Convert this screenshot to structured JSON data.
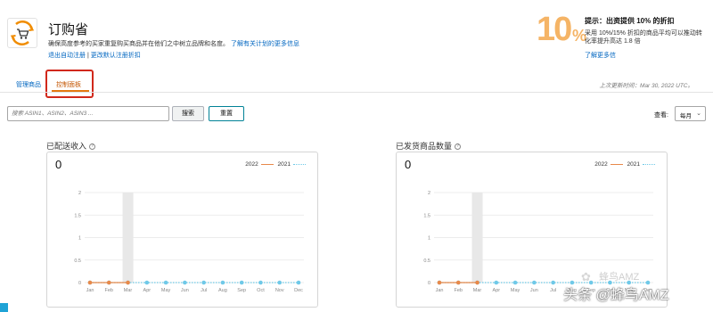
{
  "header": {
    "title": "订购省",
    "description": "确保高度参考的买家重复购买商品并在他们之中树立品牌和名度。",
    "learn_more": "了解有关计划的更多信息",
    "link_auto_enroll": "退出自动注册",
    "link_separator": "|",
    "link_change_default": "更改默认注册折扣"
  },
  "promo": {
    "number": "10",
    "percent": "%",
    "title": "提示：出资提供 10% 的折扣",
    "description": "采用 10%/15% 折扣的商品平均可以推动转化率提升高达 1.8 倍",
    "link": "了解更多信"
  },
  "tabs": {
    "manage": "管理商品",
    "dashboard": "控制面板"
  },
  "last_updated": "上次更新时间：Mar 30, 2022 UTC。",
  "search": {
    "placeholder": "搜索 ASIN1、ASIN2、ASIN3 ...",
    "search_button": "搜索",
    "reset_button": "重置"
  },
  "view": {
    "label": "查看:",
    "selected": "每月"
  },
  "colors": {
    "series_2022": "#e8894a",
    "series_2021": "#6fc9e8",
    "tab_highlight": "#d1281b",
    "promo": "#f5b466"
  },
  "chart_data": [
    {
      "type": "line",
      "title": "已配送收入",
      "total_label": "0",
      "categories": [
        "Jan",
        "Feb",
        "Mar",
        "Apr",
        "May",
        "Jun",
        "Jul",
        "Aug",
        "Sep",
        "Oct",
        "Nov",
        "Dec"
      ],
      "y_ticks": [
        "0",
        "0.5",
        "1",
        "1.5",
        "2"
      ],
      "ylim": [
        0,
        2
      ],
      "highlight_category": "Mar",
      "series": [
        {
          "name": "2022",
          "values": [
            0,
            0,
            0
          ]
        },
        {
          "name": "2021",
          "values": [
            0,
            0,
            0,
            0,
            0,
            0,
            0,
            0,
            0,
            0,
            0,
            0
          ]
        }
      ]
    },
    {
      "type": "line",
      "title": "已发货商品数量",
      "total_label": "0",
      "categories": [
        "Jan",
        "Feb",
        "Mar",
        "Apr",
        "May",
        "Jun",
        "Jul",
        "Aug",
        "Sep",
        "Oct",
        "Nov",
        "Dec"
      ],
      "y_ticks": [
        "0",
        "0.5",
        "1",
        "1.5",
        "2"
      ],
      "ylim": [
        0,
        2
      ],
      "highlight_category": "Mar",
      "series": [
        {
          "name": "2022",
          "values": [
            0,
            0,
            0
          ]
        },
        {
          "name": "2021",
          "values": [
            0,
            0,
            0,
            0,
            0,
            0,
            0,
            0,
            0,
            0,
            0,
            0
          ]
        }
      ]
    }
  ],
  "watermark": {
    "text": "蜂鸟AMZ",
    "source": "头条 @蜂鸟AMZ"
  }
}
